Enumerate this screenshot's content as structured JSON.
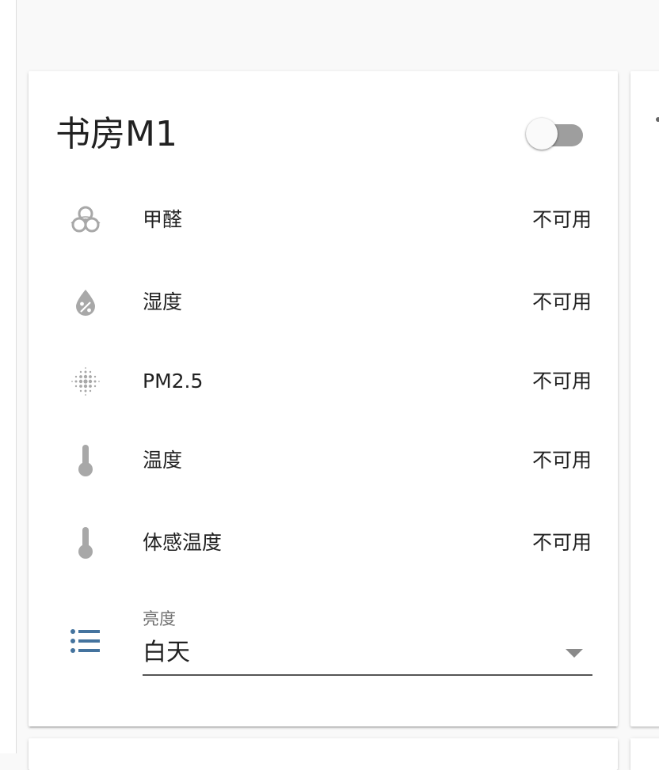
{
  "card": {
    "title": "书房M1",
    "power_toggle": {
      "on": false
    },
    "entities": [
      {
        "icon": "biohazard-icon",
        "label": "甲醛",
        "value": "不可用"
      },
      {
        "icon": "water-percent-icon",
        "label": "湿度",
        "value": "不可用"
      },
      {
        "icon": "particles-dots-icon",
        "label": "PM2.5",
        "value": "不可用"
      },
      {
        "icon": "thermometer-icon",
        "label": "温度",
        "value": "不可用"
      },
      {
        "icon": "thermometer-icon",
        "label": "体感温度",
        "value": "不可用"
      }
    ],
    "brightness_select": {
      "icon": "format-list-bulleted-icon",
      "label": "亮度",
      "selected": "白天"
    }
  },
  "colors": {
    "background": "#f9f9f9",
    "card": "#ffffff",
    "icon_grey": "#a8a8a8",
    "list_icon_blue": "#44739e",
    "toggle_track": "#9e9e9e",
    "text": "#212121",
    "secondary_text": "#727272"
  }
}
